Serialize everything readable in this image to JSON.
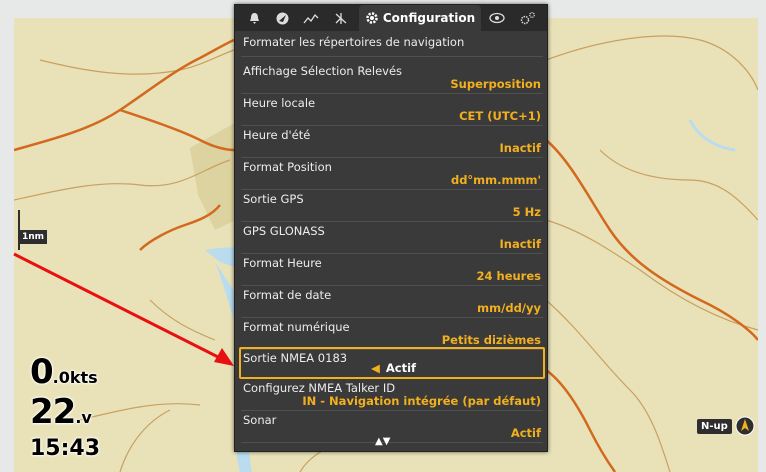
{
  "tabs": [
    {
      "icon": "bell-icon"
    },
    {
      "icon": "navigation-icon"
    },
    {
      "icon": "chart-icon"
    },
    {
      "icon": "radar-icon"
    },
    {
      "icon": "gear-icon",
      "label": "Configuration"
    },
    {
      "icon": "eye-icon"
    },
    {
      "icon": "settings-gears-icon"
    }
  ],
  "menu": {
    "header_item": "Formater les répertoires de navigation",
    "items": [
      {
        "label": "Affichage Sélection Relevés",
        "value": "Superposition"
      },
      {
        "label": "Heure locale",
        "value": "CET (UTC+1)"
      },
      {
        "label": "Heure d'été",
        "value": "Inactif"
      },
      {
        "label": "Format Position",
        "value": "dd°mm.mmm'"
      },
      {
        "label": "Sortie GPS",
        "value": "5 Hz"
      },
      {
        "label": "GPS GLONASS",
        "value": "Inactif"
      },
      {
        "label": "Format Heure",
        "value": "24 heures"
      },
      {
        "label": "Format de date",
        "value": "mm/dd/yy"
      },
      {
        "label": "Format numérique",
        "value": "Petits dizièmes"
      },
      {
        "label": "Sortie NMEA 0183",
        "value": "Actif",
        "selected": true
      },
      {
        "label": "Configurez NMEA Talker ID",
        "value": "IN - Navigation intégrée (par défaut)"
      },
      {
        "label": "Sonar",
        "value": "Actif"
      }
    ]
  },
  "map": {
    "scale": "1nm",
    "speed_value": "0",
    "speed_unit": ".0kts",
    "voltage_value": "22",
    "voltage_unit": ".v",
    "time": "15:43",
    "orientation": "N-up"
  },
  "colors": {
    "accent": "#f2b01e",
    "menu_bg": "#3a3a3a",
    "land": "#e9e2b8",
    "water": "#b9dcef",
    "road": "#d2691e",
    "annotation_arrow": "#e81010"
  }
}
